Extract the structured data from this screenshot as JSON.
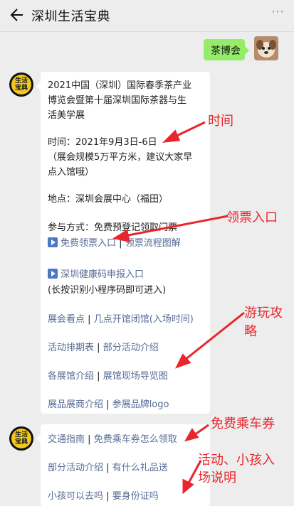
{
  "header": {
    "title": "深圳生活宝典",
    "more": "⋯"
  },
  "me": {
    "message": "茶博会"
  },
  "bot": {
    "avatar_text_1": "生活",
    "avatar_text_2": "宝典"
  },
  "card1": {
    "title_1": "2021中国（深圳）国际春季茶产业",
    "title_2": "博览会暨第十届深圳国际茶器与生",
    "title_3": "活美学展",
    "time": "时间：2021年9月3日-6日",
    "note_1": "（展会规模5万平方米，建议大家早",
    "note_2": "点入馆哦）",
    "place": "地点：深圳会展中心（福田）",
    "method": "参与方式：免费预登记领取门票",
    "ticket_link": "免费领票入口",
    "sep": "|",
    "flow_link": "领票流程图解",
    "health_link": "深圳健康码申报入口",
    "health_note": "(长按识别小程序码即可进入)",
    "links": [
      [
        "展会看点",
        "几点开馆闭馆(入场时间)"
      ],
      [
        "活动排期表",
        "部分活动介绍"
      ],
      [
        "各展馆介绍",
        "展馆现场导览图"
      ],
      [
        "展品展商介绍",
        "参展品牌logo"
      ]
    ]
  },
  "card2": {
    "links": [
      [
        "交通指南",
        "免费乘车券怎么领取"
      ],
      [
        "部分活动介绍",
        "有什么礼品送"
      ],
      [
        "小孩可以去吗",
        "要身份证吗"
      ]
    ]
  },
  "annotations": {
    "time": "时间",
    "ticket": "领票入口",
    "play_1": "游玩攻",
    "play_2": "略",
    "bus": "免费乘车券",
    "kids_1": "活动、小孩入",
    "kids_2": "场说明"
  },
  "colors": {
    "link": "#576b95",
    "annotation": "#e8262b",
    "bubble": "#95ec69"
  }
}
